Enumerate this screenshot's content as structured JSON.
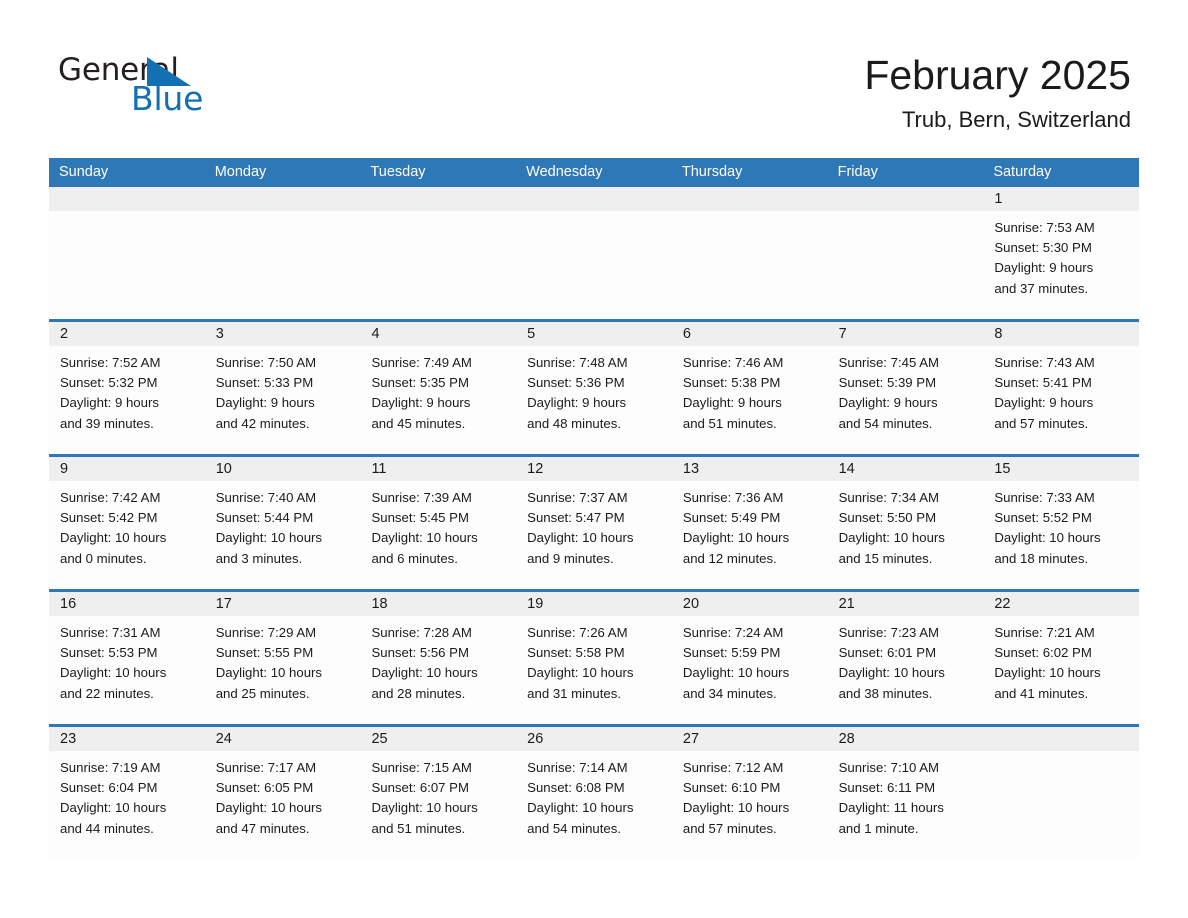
{
  "logo": {
    "word_one": "General",
    "word_two": "Blue",
    "triangle_color": "#1470b5"
  },
  "header": {
    "month_title": "February 2025",
    "location": "Trub, Bern, Switzerland"
  },
  "colors": {
    "accent_blue": "#2f78b8",
    "header_text": "#ffffff",
    "daynum_band": "#efefef",
    "cell_background": "#fdfdfd",
    "body_text": "#1b1b1b"
  },
  "calendar": {
    "weekday_headers": [
      "Sunday",
      "Monday",
      "Tuesday",
      "Wednesday",
      "Thursday",
      "Friday",
      "Saturday"
    ],
    "weeks": [
      [
        {
          "day": "",
          "lines": []
        },
        {
          "day": "",
          "lines": []
        },
        {
          "day": "",
          "lines": []
        },
        {
          "day": "",
          "lines": []
        },
        {
          "day": "",
          "lines": []
        },
        {
          "day": "",
          "lines": []
        },
        {
          "day": "1",
          "lines": [
            "Sunrise: 7:53 AM",
            "Sunset: 5:30 PM",
            "Daylight: 9 hours",
            "and 37 minutes."
          ]
        }
      ],
      [
        {
          "day": "2",
          "lines": [
            "Sunrise: 7:52 AM",
            "Sunset: 5:32 PM",
            "Daylight: 9 hours",
            "and 39 minutes."
          ]
        },
        {
          "day": "3",
          "lines": [
            "Sunrise: 7:50 AM",
            "Sunset: 5:33 PM",
            "Daylight: 9 hours",
            "and 42 minutes."
          ]
        },
        {
          "day": "4",
          "lines": [
            "Sunrise: 7:49 AM",
            "Sunset: 5:35 PM",
            "Daylight: 9 hours",
            "and 45 minutes."
          ]
        },
        {
          "day": "5",
          "lines": [
            "Sunrise: 7:48 AM",
            "Sunset: 5:36 PM",
            "Daylight: 9 hours",
            "and 48 minutes."
          ]
        },
        {
          "day": "6",
          "lines": [
            "Sunrise: 7:46 AM",
            "Sunset: 5:38 PM",
            "Daylight: 9 hours",
            "and 51 minutes."
          ]
        },
        {
          "day": "7",
          "lines": [
            "Sunrise: 7:45 AM",
            "Sunset: 5:39 PM",
            "Daylight: 9 hours",
            "and 54 minutes."
          ]
        },
        {
          "day": "8",
          "lines": [
            "Sunrise: 7:43 AM",
            "Sunset: 5:41 PM",
            "Daylight: 9 hours",
            "and 57 minutes."
          ]
        }
      ],
      [
        {
          "day": "9",
          "lines": [
            "Sunrise: 7:42 AM",
            "Sunset: 5:42 PM",
            "Daylight: 10 hours",
            "and 0 minutes."
          ]
        },
        {
          "day": "10",
          "lines": [
            "Sunrise: 7:40 AM",
            "Sunset: 5:44 PM",
            "Daylight: 10 hours",
            "and 3 minutes."
          ]
        },
        {
          "day": "11",
          "lines": [
            "Sunrise: 7:39 AM",
            "Sunset: 5:45 PM",
            "Daylight: 10 hours",
            "and 6 minutes."
          ]
        },
        {
          "day": "12",
          "lines": [
            "Sunrise: 7:37 AM",
            "Sunset: 5:47 PM",
            "Daylight: 10 hours",
            "and 9 minutes."
          ]
        },
        {
          "day": "13",
          "lines": [
            "Sunrise: 7:36 AM",
            "Sunset: 5:49 PM",
            "Daylight: 10 hours",
            "and 12 minutes."
          ]
        },
        {
          "day": "14",
          "lines": [
            "Sunrise: 7:34 AM",
            "Sunset: 5:50 PM",
            "Daylight: 10 hours",
            "and 15 minutes."
          ]
        },
        {
          "day": "15",
          "lines": [
            "Sunrise: 7:33 AM",
            "Sunset: 5:52 PM",
            "Daylight: 10 hours",
            "and 18 minutes."
          ]
        }
      ],
      [
        {
          "day": "16",
          "lines": [
            "Sunrise: 7:31 AM",
            "Sunset: 5:53 PM",
            "Daylight: 10 hours",
            "and 22 minutes."
          ]
        },
        {
          "day": "17",
          "lines": [
            "Sunrise: 7:29 AM",
            "Sunset: 5:55 PM",
            "Daylight: 10 hours",
            "and 25 minutes."
          ]
        },
        {
          "day": "18",
          "lines": [
            "Sunrise: 7:28 AM",
            "Sunset: 5:56 PM",
            "Daylight: 10 hours",
            "and 28 minutes."
          ]
        },
        {
          "day": "19",
          "lines": [
            "Sunrise: 7:26 AM",
            "Sunset: 5:58 PM",
            "Daylight: 10 hours",
            "and 31 minutes."
          ]
        },
        {
          "day": "20",
          "lines": [
            "Sunrise: 7:24 AM",
            "Sunset: 5:59 PM",
            "Daylight: 10 hours",
            "and 34 minutes."
          ]
        },
        {
          "day": "21",
          "lines": [
            "Sunrise: 7:23 AM",
            "Sunset: 6:01 PM",
            "Daylight: 10 hours",
            "and 38 minutes."
          ]
        },
        {
          "day": "22",
          "lines": [
            "Sunrise: 7:21 AM",
            "Sunset: 6:02 PM",
            "Daylight: 10 hours",
            "and 41 minutes."
          ]
        }
      ],
      [
        {
          "day": "23",
          "lines": [
            "Sunrise: 7:19 AM",
            "Sunset: 6:04 PM",
            "Daylight: 10 hours",
            "and 44 minutes."
          ]
        },
        {
          "day": "24",
          "lines": [
            "Sunrise: 7:17 AM",
            "Sunset: 6:05 PM",
            "Daylight: 10 hours",
            "and 47 minutes."
          ]
        },
        {
          "day": "25",
          "lines": [
            "Sunrise: 7:15 AM",
            "Sunset: 6:07 PM",
            "Daylight: 10 hours",
            "and 51 minutes."
          ]
        },
        {
          "day": "26",
          "lines": [
            "Sunrise: 7:14 AM",
            "Sunset: 6:08 PM",
            "Daylight: 10 hours",
            "and 54 minutes."
          ]
        },
        {
          "day": "27",
          "lines": [
            "Sunrise: 7:12 AM",
            "Sunset: 6:10 PM",
            "Daylight: 10 hours",
            "and 57 minutes."
          ]
        },
        {
          "day": "28",
          "lines": [
            "Sunrise: 7:10 AM",
            "Sunset: 6:11 PM",
            "Daylight: 11 hours",
            "and 1 minute."
          ]
        },
        {
          "day": "",
          "lines": []
        }
      ]
    ]
  }
}
